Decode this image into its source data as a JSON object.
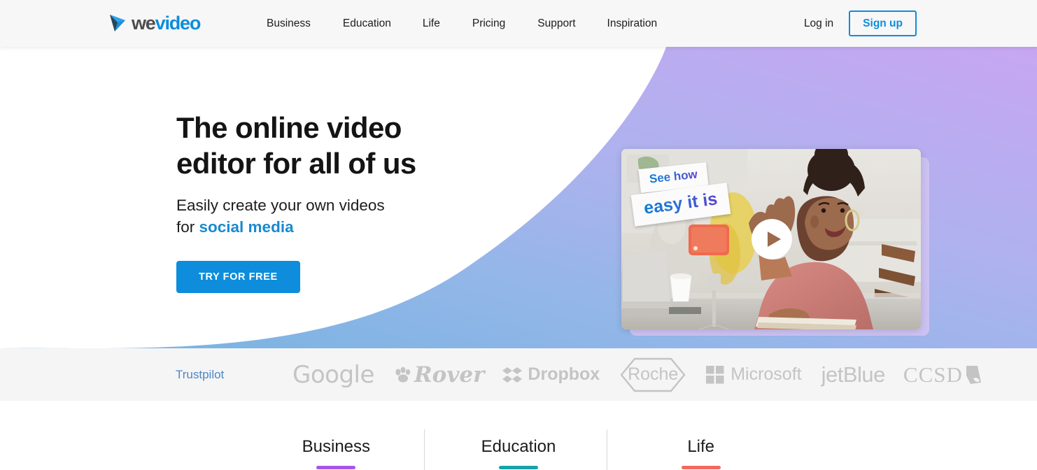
{
  "header": {
    "logo": {
      "icon": "play-triangle-icon",
      "text_part1": "we",
      "text_part2": "video"
    },
    "nav": [
      {
        "label": "Business"
      },
      {
        "label": "Education"
      },
      {
        "label": "Life"
      },
      {
        "label": "Pricing"
      },
      {
        "label": "Support"
      },
      {
        "label": "Inspiration"
      }
    ],
    "login_label": "Log in",
    "signup_label": "Sign up"
  },
  "hero": {
    "title_line1": "The online video",
    "title_line2": "editor for all of us",
    "sub_line1": "Easily create your own videos",
    "sub_prefix": "for ",
    "sub_highlight": "social media",
    "cta_label": "TRY FOR FREE",
    "video": {
      "sticker_1": "See how",
      "sticker_2": "easy it is",
      "play_icon": "play-icon",
      "alt": "Woman smiling at desk with laptop and phone on tripod"
    }
  },
  "logo_band": {
    "trustpilot_label": "Trustpilot",
    "brands": [
      {
        "name": "Google"
      },
      {
        "name": "Rover"
      },
      {
        "name": "Dropbox"
      },
      {
        "name": "Roche"
      },
      {
        "name": "Microsoft"
      },
      {
        "name": "jetBlue"
      },
      {
        "name": "CCSD"
      }
    ]
  },
  "categories": [
    {
      "label": "Business",
      "color": "#a855e8"
    },
    {
      "label": "Education",
      "color": "#17a2a8"
    },
    {
      "label": "Life",
      "color": "#f4685e"
    }
  ],
  "colors": {
    "brand_blue": "#0d8ddb",
    "hero_curve_blue": "#74b3e0",
    "hero_purple_top": "#c3a8f0",
    "hero_purple_bottom": "#aab4ee",
    "header_bg": "#f7f7f7",
    "band_bg": "#f5f5f5"
  }
}
